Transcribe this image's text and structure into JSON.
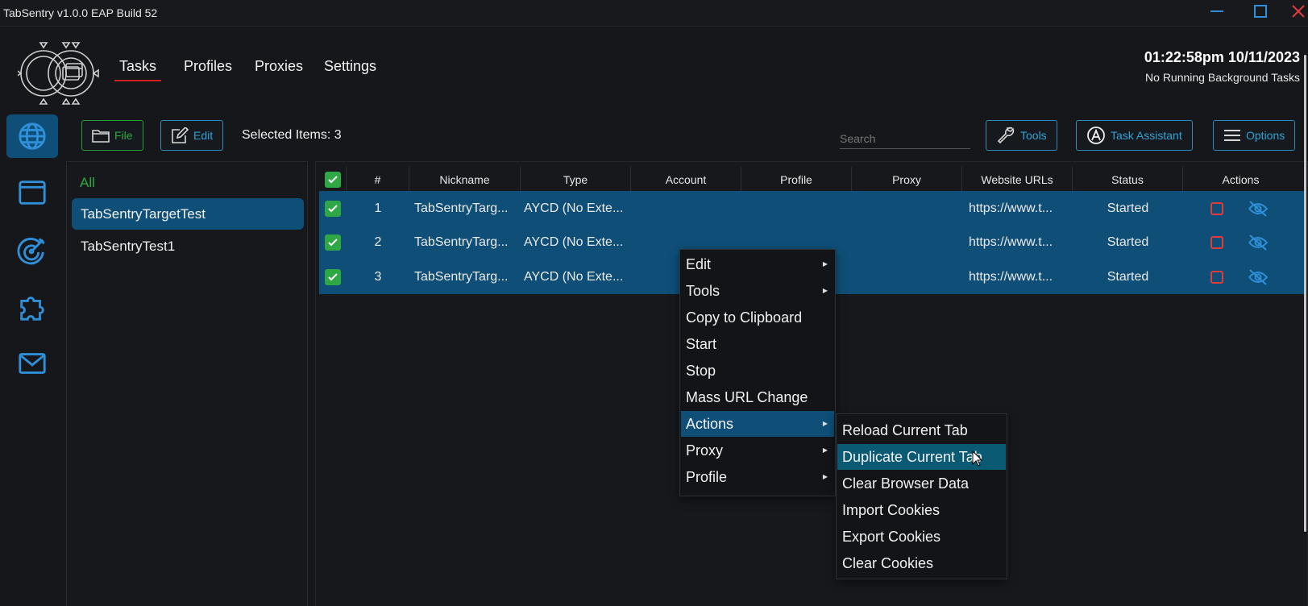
{
  "window": {
    "title": "TabSentry v1.0.0 EAP Build 52",
    "minimize": "—",
    "maximize": "☐",
    "close": "✕"
  },
  "nav": {
    "tabs": [
      "Tasks",
      "Profiles",
      "Proxies",
      "Settings"
    ],
    "active": "Tasks"
  },
  "status": {
    "clock": "01:22:58pm 10/11/2023",
    "background": "No Running Background Tasks"
  },
  "sidebar": {
    "icons": [
      "globe-icon",
      "browser-window-icon",
      "target-icon",
      "puzzle-icon",
      "mail-icon"
    ],
    "active": "globe-icon"
  },
  "toolbar": {
    "file_label": "File",
    "edit_label": "Edit",
    "selected_items": "Selected Items: 3",
    "search_placeholder": "Search",
    "tools_label": "Tools",
    "assistant_label": "Task Assistant",
    "options_label": "Options"
  },
  "groups": {
    "all_label": "All",
    "items": [
      "TabSentryTargetTest",
      "TabSentryTest1"
    ],
    "active": "TabSentryTargetTest"
  },
  "table": {
    "columns": [
      "#",
      "Nickname",
      "Type",
      "Account",
      "Profile",
      "Proxy",
      "Website URLs",
      "Status",
      "Actions"
    ],
    "rows": [
      {
        "num": "1",
        "nickname": "TabSentryTarg...",
        "type": "AYCD (No Exte...",
        "account": "",
        "profile": "",
        "proxy": "",
        "url": "https://www.t...",
        "status": "Started"
      },
      {
        "num": "2",
        "nickname": "TabSentryTarg...",
        "type": "AYCD (No Exte...",
        "account": "",
        "profile": "",
        "proxy": "",
        "url": "https://www.t...",
        "status": "Started"
      },
      {
        "num": "3",
        "nickname": "TabSentryTarg...",
        "type": "AYCD (No Exte...",
        "account": "",
        "profile": "",
        "proxy": "",
        "url": "https://www.t...",
        "status": "Started"
      }
    ]
  },
  "context_menu": {
    "items": [
      "Edit",
      "Tools",
      "Copy to Clipboard",
      "Start",
      "Stop",
      "Mass URL Change",
      "Actions",
      "Proxy",
      "Profile"
    ],
    "has_submenu": [
      true,
      true,
      false,
      false,
      false,
      false,
      true,
      true,
      true
    ],
    "highlighted": "Actions"
  },
  "submenu": {
    "items": [
      "Reload Current Tab",
      "Duplicate Current Tab",
      "Clear Browser Data",
      "Import Cookies",
      "Export Cookies",
      "Clear Cookies"
    ],
    "highlighted": "Duplicate Current Tab"
  },
  "colors": {
    "accent_blue": "#2fa3d6",
    "selection": "#0e4e77",
    "green": "#2ea844",
    "red": "#e23b3b",
    "background": "#15171b"
  }
}
